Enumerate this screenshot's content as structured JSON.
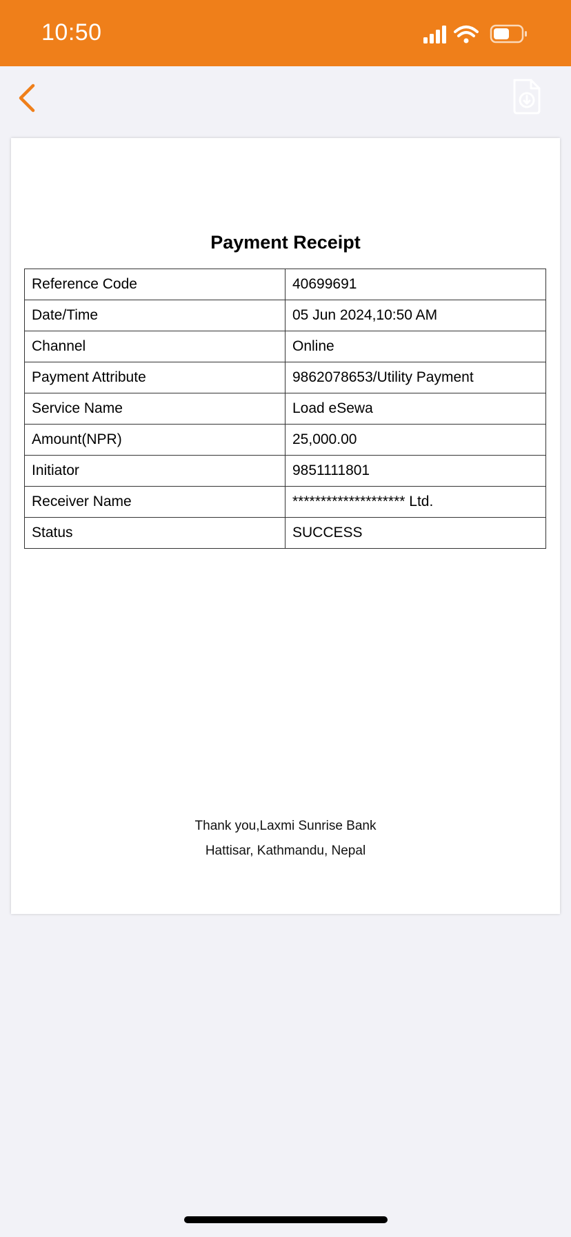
{
  "status_bar": {
    "time": "10:50",
    "background_color": "#ef7f1a",
    "icons": [
      "cellular-signal-icon",
      "wifi-icon",
      "battery-icon"
    ]
  },
  "nav": {
    "back_icon": "chevron-left-icon",
    "download_icon": "document-download-icon",
    "accent_color": "#ef7f1a"
  },
  "receipt": {
    "title": "Payment Receipt",
    "rows": [
      {
        "label": "Reference Code",
        "value": "40699691"
      },
      {
        "label": "Date/Time",
        "value": "05 Jun 2024,10:50 AM"
      },
      {
        "label": "Channel",
        "value": "Online"
      },
      {
        "label": "Payment Attribute",
        "value": "9862078653/Utility Payment"
      },
      {
        "label": "Service Name",
        "value": "Load eSewa"
      },
      {
        "label": "Amount(NPR)",
        "value": "25,000.00"
      },
      {
        "label": "Initiator",
        "value": "9851111801"
      },
      {
        "label": "Receiver Name",
        "value": "******************** Ltd."
      },
      {
        "label": "Status",
        "value": "SUCCESS"
      }
    ],
    "footer_line1": "Thank you,Laxmi Sunrise Bank",
    "footer_line2": "Hattisar, Kathmandu, Nepal"
  }
}
